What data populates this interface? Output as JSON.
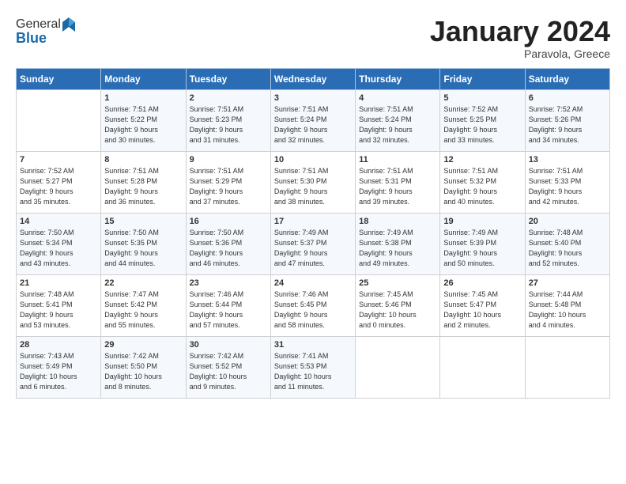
{
  "header": {
    "logo_line1": "General",
    "logo_line2": "Blue",
    "month": "January 2024",
    "location": "Paravola, Greece"
  },
  "days_of_week": [
    "Sunday",
    "Monday",
    "Tuesday",
    "Wednesday",
    "Thursday",
    "Friday",
    "Saturday"
  ],
  "weeks": [
    [
      {
        "day": "",
        "content": ""
      },
      {
        "day": "1",
        "content": "Sunrise: 7:51 AM\nSunset: 5:22 PM\nDaylight: 9 hours\nand 30 minutes."
      },
      {
        "day": "2",
        "content": "Sunrise: 7:51 AM\nSunset: 5:23 PM\nDaylight: 9 hours\nand 31 minutes."
      },
      {
        "day": "3",
        "content": "Sunrise: 7:51 AM\nSunset: 5:24 PM\nDaylight: 9 hours\nand 32 minutes."
      },
      {
        "day": "4",
        "content": "Sunrise: 7:51 AM\nSunset: 5:24 PM\nDaylight: 9 hours\nand 32 minutes."
      },
      {
        "day": "5",
        "content": "Sunrise: 7:52 AM\nSunset: 5:25 PM\nDaylight: 9 hours\nand 33 minutes."
      },
      {
        "day": "6",
        "content": "Sunrise: 7:52 AM\nSunset: 5:26 PM\nDaylight: 9 hours\nand 34 minutes."
      }
    ],
    [
      {
        "day": "7",
        "content": "Sunrise: 7:52 AM\nSunset: 5:27 PM\nDaylight: 9 hours\nand 35 minutes."
      },
      {
        "day": "8",
        "content": "Sunrise: 7:51 AM\nSunset: 5:28 PM\nDaylight: 9 hours\nand 36 minutes."
      },
      {
        "day": "9",
        "content": "Sunrise: 7:51 AM\nSunset: 5:29 PM\nDaylight: 9 hours\nand 37 minutes."
      },
      {
        "day": "10",
        "content": "Sunrise: 7:51 AM\nSunset: 5:30 PM\nDaylight: 9 hours\nand 38 minutes."
      },
      {
        "day": "11",
        "content": "Sunrise: 7:51 AM\nSunset: 5:31 PM\nDaylight: 9 hours\nand 39 minutes."
      },
      {
        "day": "12",
        "content": "Sunrise: 7:51 AM\nSunset: 5:32 PM\nDaylight: 9 hours\nand 40 minutes."
      },
      {
        "day": "13",
        "content": "Sunrise: 7:51 AM\nSunset: 5:33 PM\nDaylight: 9 hours\nand 42 minutes."
      }
    ],
    [
      {
        "day": "14",
        "content": "Sunrise: 7:50 AM\nSunset: 5:34 PM\nDaylight: 9 hours\nand 43 minutes."
      },
      {
        "day": "15",
        "content": "Sunrise: 7:50 AM\nSunset: 5:35 PM\nDaylight: 9 hours\nand 44 minutes."
      },
      {
        "day": "16",
        "content": "Sunrise: 7:50 AM\nSunset: 5:36 PM\nDaylight: 9 hours\nand 46 minutes."
      },
      {
        "day": "17",
        "content": "Sunrise: 7:49 AM\nSunset: 5:37 PM\nDaylight: 9 hours\nand 47 minutes."
      },
      {
        "day": "18",
        "content": "Sunrise: 7:49 AM\nSunset: 5:38 PM\nDaylight: 9 hours\nand 49 minutes."
      },
      {
        "day": "19",
        "content": "Sunrise: 7:49 AM\nSunset: 5:39 PM\nDaylight: 9 hours\nand 50 minutes."
      },
      {
        "day": "20",
        "content": "Sunrise: 7:48 AM\nSunset: 5:40 PM\nDaylight: 9 hours\nand 52 minutes."
      }
    ],
    [
      {
        "day": "21",
        "content": "Sunrise: 7:48 AM\nSunset: 5:41 PM\nDaylight: 9 hours\nand 53 minutes."
      },
      {
        "day": "22",
        "content": "Sunrise: 7:47 AM\nSunset: 5:42 PM\nDaylight: 9 hours\nand 55 minutes."
      },
      {
        "day": "23",
        "content": "Sunrise: 7:46 AM\nSunset: 5:44 PM\nDaylight: 9 hours\nand 57 minutes."
      },
      {
        "day": "24",
        "content": "Sunrise: 7:46 AM\nSunset: 5:45 PM\nDaylight: 9 hours\nand 58 minutes."
      },
      {
        "day": "25",
        "content": "Sunrise: 7:45 AM\nSunset: 5:46 PM\nDaylight: 10 hours\nand 0 minutes."
      },
      {
        "day": "26",
        "content": "Sunrise: 7:45 AM\nSunset: 5:47 PM\nDaylight: 10 hours\nand 2 minutes."
      },
      {
        "day": "27",
        "content": "Sunrise: 7:44 AM\nSunset: 5:48 PM\nDaylight: 10 hours\nand 4 minutes."
      }
    ],
    [
      {
        "day": "28",
        "content": "Sunrise: 7:43 AM\nSunset: 5:49 PM\nDaylight: 10 hours\nand 6 minutes."
      },
      {
        "day": "29",
        "content": "Sunrise: 7:42 AM\nSunset: 5:50 PM\nDaylight: 10 hours\nand 8 minutes."
      },
      {
        "day": "30",
        "content": "Sunrise: 7:42 AM\nSunset: 5:52 PM\nDaylight: 10 hours\nand 9 minutes."
      },
      {
        "day": "31",
        "content": "Sunrise: 7:41 AM\nSunset: 5:53 PM\nDaylight: 10 hours\nand 11 minutes."
      },
      {
        "day": "",
        "content": ""
      },
      {
        "day": "",
        "content": ""
      },
      {
        "day": "",
        "content": ""
      }
    ]
  ]
}
